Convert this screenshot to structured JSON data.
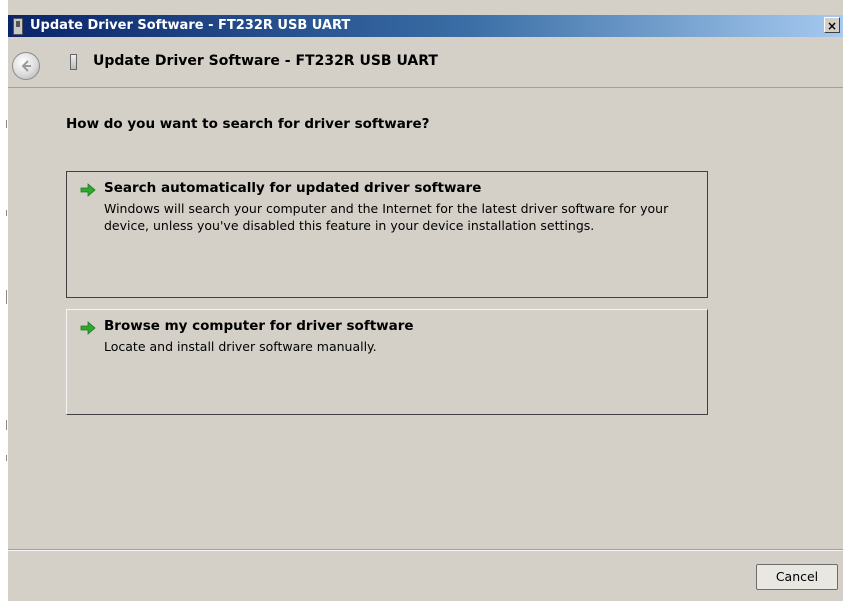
{
  "window": {
    "title": "Update Driver Software - FT232R USB UART",
    "close_glyph": "×"
  },
  "header": {
    "title": "Update Driver Software - FT232R USB UART",
    "back_icon": "back-arrow-icon",
    "device_icon": "usb-device-icon"
  },
  "main": {
    "question": "How do you want to search for driver software?",
    "options": [
      {
        "title": "Search automatically for updated driver software",
        "description": "Windows will search your computer and the Internet for the latest driver software for your device, unless you've disabled this feature in your device installation settings.",
        "icon": "green-arrow-icon"
      },
      {
        "title": "Browse my computer for driver software",
        "description": "Locate and install driver software manually.",
        "icon": "green-arrow-icon"
      }
    ]
  },
  "footer": {
    "cancel_label": "Cancel"
  },
  "colors": {
    "dialog_bg": "#d4d0c8",
    "titlebar_start": "#0a246a",
    "titlebar_end": "#a6caf0",
    "arrow_green": "#2fa82f"
  }
}
